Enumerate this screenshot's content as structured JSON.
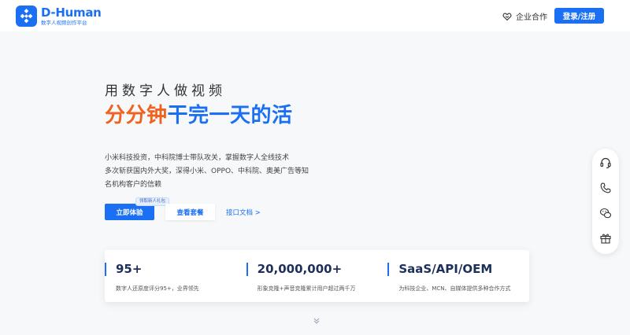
{
  "brand": {
    "name": "D-Human",
    "tagline": "数字人视频创作平台",
    "primary_color": "#1a6ff3",
    "accent_color": "#f0621d"
  },
  "header": {
    "business_label": "企业合作",
    "business_icon": "handshake-icon",
    "login_label": "登录/注册"
  },
  "hero": {
    "kicker": "用数字人做视频",
    "headline_accent": "分分钟",
    "headline_rest": "干完一天的活",
    "description_lines": [
      "小米科技投资，中科院博士带队攻关，掌握数字人全线技术",
      "多次斩获国内外大奖，深得小米、OPPO、中科院、奥美广告等知",
      "名机构客户的信赖"
    ],
    "cta_label": "立即体验",
    "cta_badge": "领取新人礼包",
    "packages_label": "查看套餐",
    "api_link_label": "接口文档 >"
  },
  "stats": [
    {
      "value": "95+",
      "desc": "数字人还原度评分95+，业界领先"
    },
    {
      "value": "20,000,000+",
      "desc": "形象克隆+声音克隆累计用户超过两千万"
    },
    {
      "value": "SaaS/API/OEM",
      "desc": "为科技企业、MCN、自媒体提供多种合作方式"
    }
  ],
  "sidebar_icons": [
    "headset-icon",
    "phone-icon",
    "wechat-icon",
    "gift-icon"
  ]
}
